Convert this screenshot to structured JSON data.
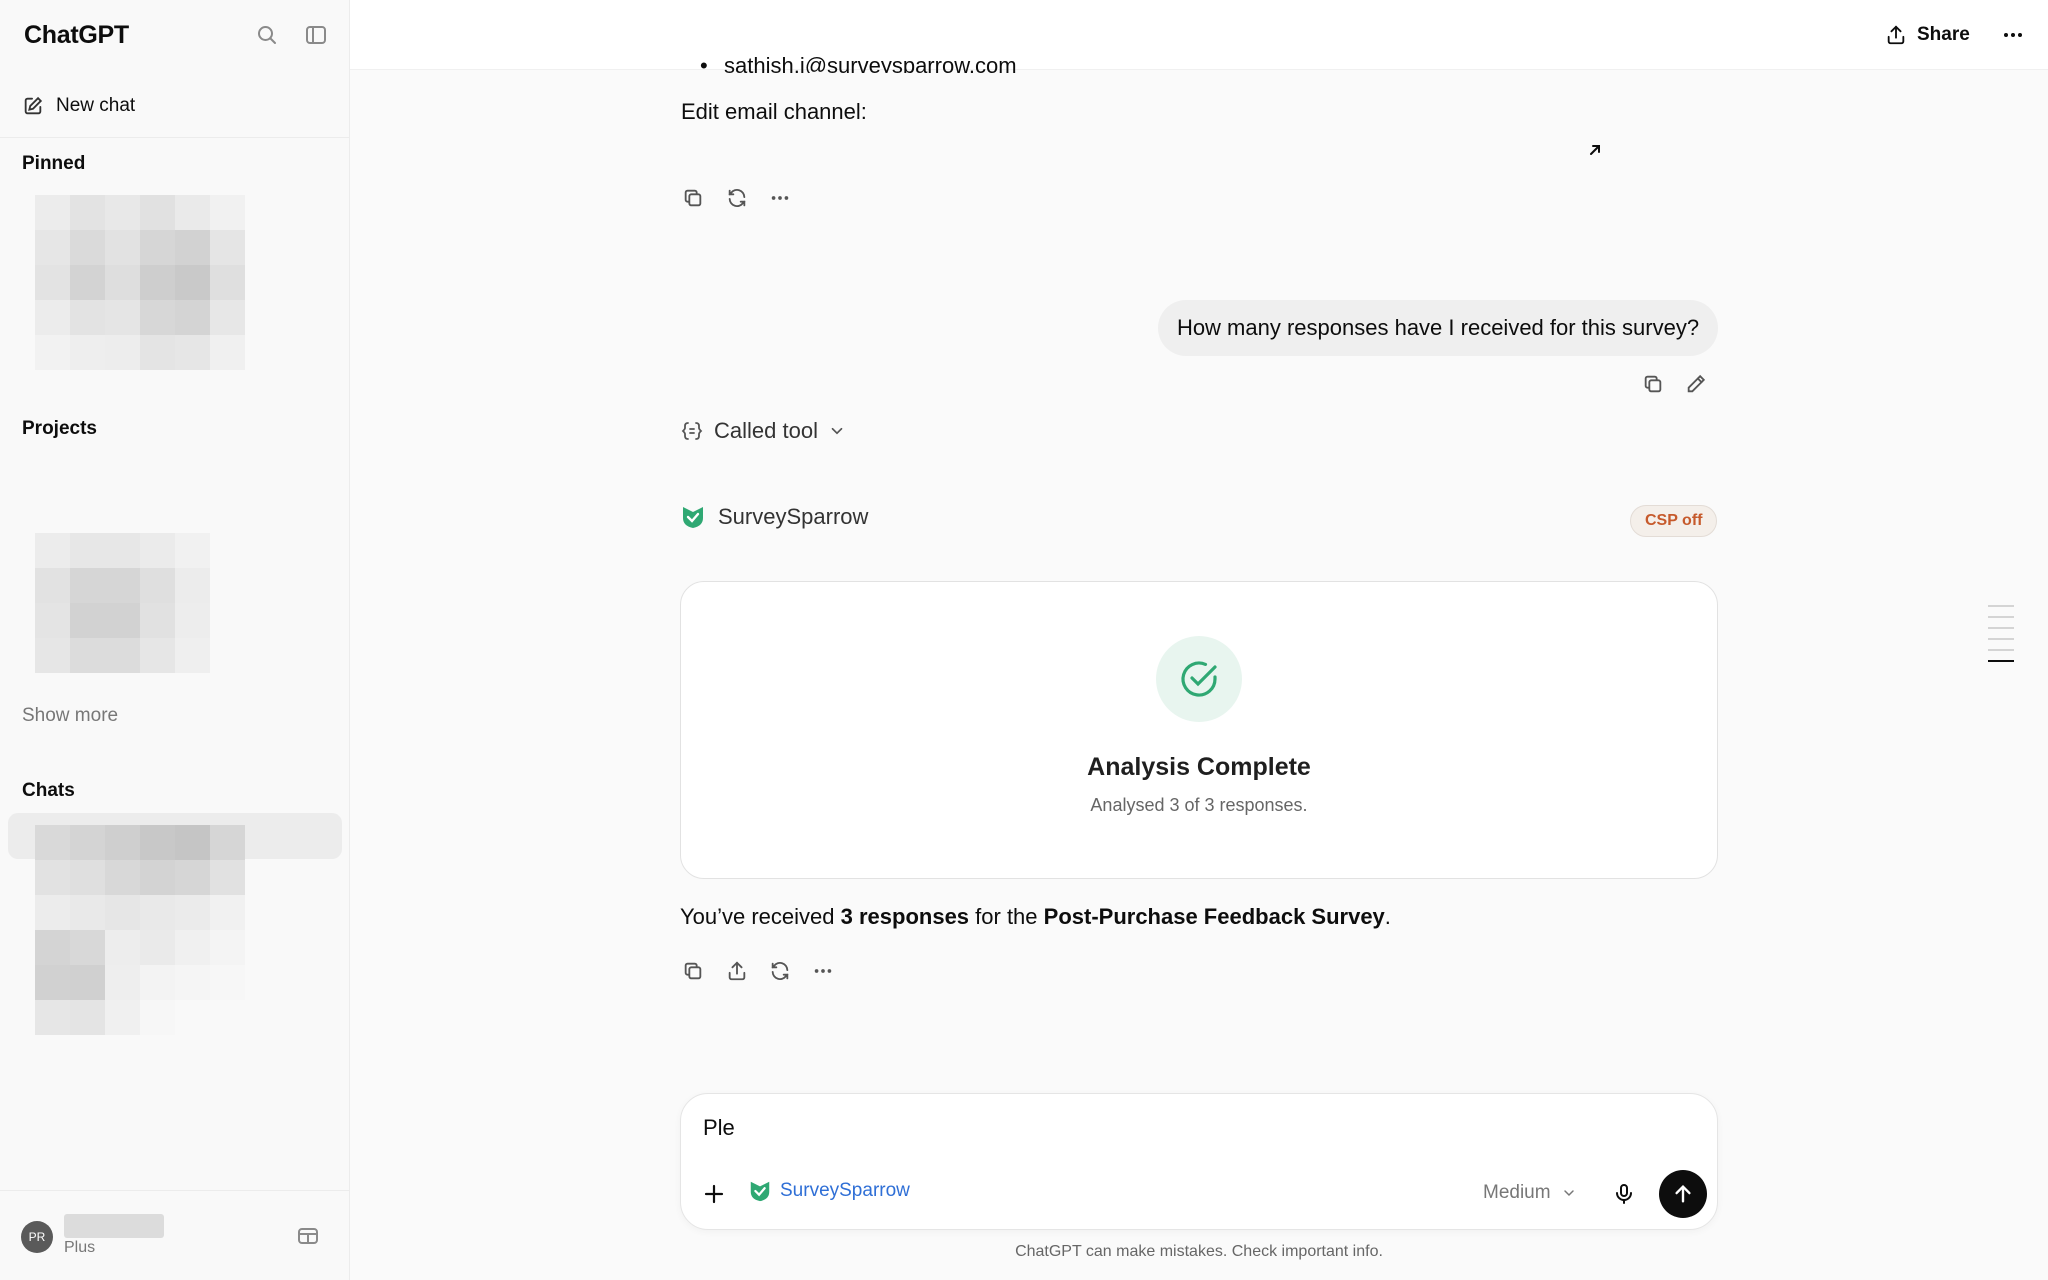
{
  "sidebar": {
    "app_title": "ChatGPT",
    "new_chat_label": "New chat",
    "pinned_label": "Pinned",
    "projects_label": "Projects",
    "show_more_label": "Show more",
    "chats_label": "Chats",
    "user": {
      "initials": "PR",
      "plan": "Plus"
    }
  },
  "topbar": {
    "share_label": "Share"
  },
  "conversation": {
    "truncated_email": "sathish.j@surveysparrow.com",
    "edit_email_text": "Edit email channel:",
    "user_message": "How many responses have I received for this survey?",
    "called_tool_label": "Called tool",
    "app_name": "SurveySparrow",
    "csp_badge": "CSP off",
    "card": {
      "title": "Analysis Complete",
      "subtitle": "Analysed 3 of 3 responses."
    },
    "answer": {
      "prefix": "You’ve received ",
      "bold1": "3 responses",
      "middle": " for the ",
      "bold2": "Post-Purchase Feedback Survey",
      "suffix": "."
    }
  },
  "composer": {
    "input_value": "Ple",
    "tool_chip": "SurveySparrow",
    "model": "Medium",
    "disclaimer": "ChatGPT can make mistakes. Check important info."
  },
  "colors": {
    "accent_green": "#2fa873",
    "link_blue": "#2f6fd6",
    "badge_orange": "#c65a2c"
  }
}
